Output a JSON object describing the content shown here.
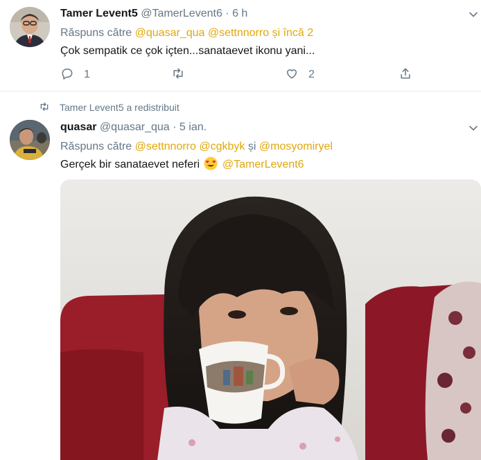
{
  "tweet1": {
    "name": "Tamer Levent5",
    "handle": "@TamerLevent6",
    "dot": "·",
    "time": "6 h",
    "replying_prefix": "Răspuns către",
    "replying_to": [
      "@quasar_qua",
      "@settnnorro"
    ],
    "replying_suffix": "și încă 2",
    "text": "Çok sempatik ce çok içten...sanataevet ikonu yani...",
    "actions": {
      "reply_icon": "reply-icon",
      "reply_count": "1",
      "retweet_icon": "retweet-icon",
      "retweet_count": "",
      "like_icon": "heart-icon",
      "like_count": "2",
      "share_icon": "share-icon"
    }
  },
  "tweet2": {
    "retweet_context": "Tamer Levent5 a redistribuit",
    "name": "quasar",
    "handle": "@quasar_qua",
    "dot": "·",
    "time": "5 ian.",
    "replying_prefix": "Răspuns către",
    "replying_to": [
      "@settnnorro",
      "@cgkbyk"
    ],
    "replying_and": "și",
    "replying_last": "@mosyomiryel",
    "text": "Gerçek bir sanataevet neferi",
    "emoji": "heart-eyes-emoji",
    "text_mention": "@TamerLevent6",
    "media": "video-thumbnail-girl-drinking-from-cup"
  },
  "colors": {
    "mention": "#e0a70c",
    "secondary_text": "#657786",
    "divider": "#e6ecf0"
  }
}
